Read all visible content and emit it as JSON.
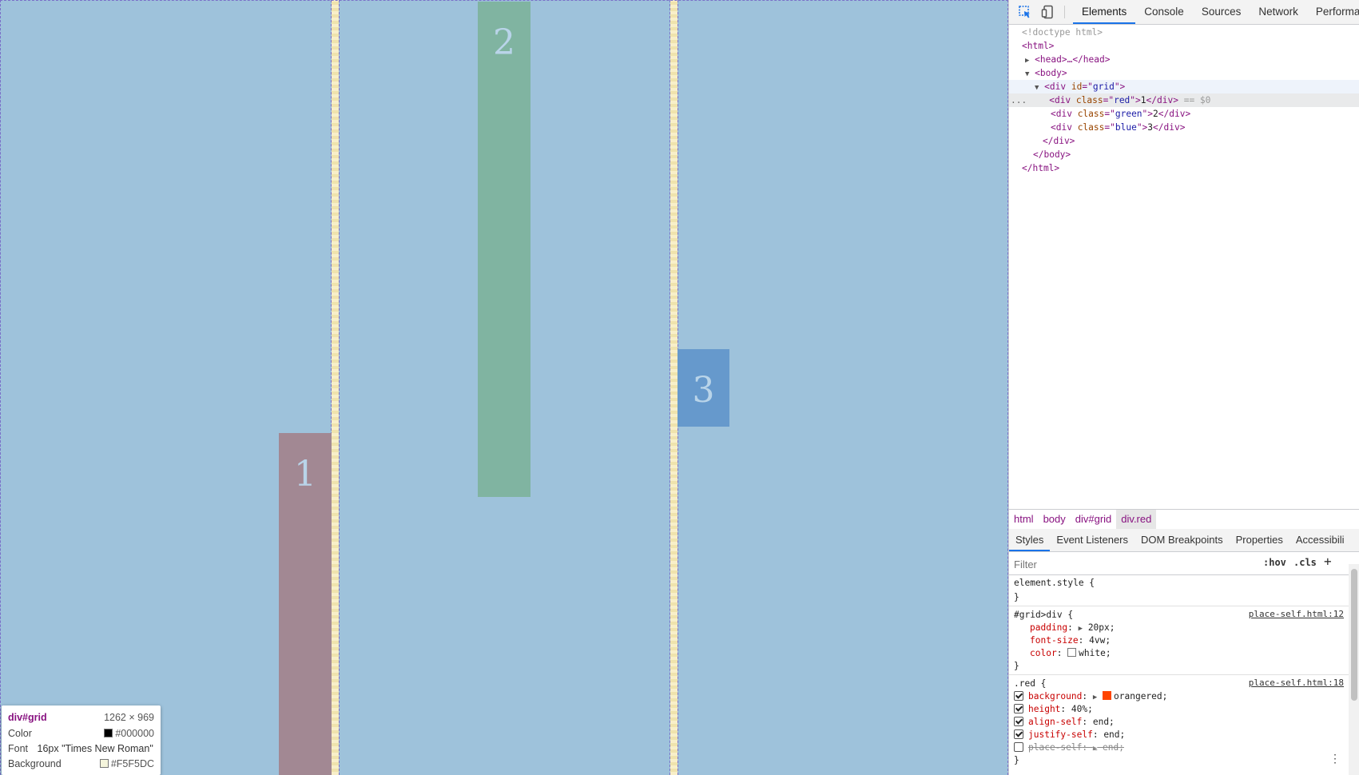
{
  "page": {
    "items": [
      {
        "label": "1",
        "class": "red",
        "color": "#A28893"
      },
      {
        "label": "2",
        "class": "green",
        "color": "#80B4A1"
      },
      {
        "label": "3",
        "class": "blue",
        "color": "#6699CC"
      }
    ],
    "column_color": "#9EC2DB",
    "gap_color": "#F5F5DC"
  },
  "tooltip": {
    "selector": "div#grid",
    "size": "1262 × 969",
    "color_label": "Color",
    "color_value": "#000000",
    "font_label": "Font",
    "font_value": "16px \"Times New Roman\"",
    "bg_label": "Background",
    "bg_value": "#F5F5DC"
  },
  "devtools": {
    "tabs": [
      "Elements",
      "Console",
      "Sources",
      "Network",
      "Performa"
    ],
    "active_tab": "Elements",
    "dom": {
      "doctype": "<!doctype html>",
      "html_open": "<html>",
      "head": "<head>…</head>",
      "body_open": "<body>",
      "grid_open_tag": "div",
      "grid_attr": "id",
      "grid_val": "grid",
      "red_attr": "class",
      "red_val": "red",
      "red_text": "1",
      "selected_marker": "== $0",
      "green_val": "green",
      "green_text": "2",
      "blue_val": "blue",
      "blue_text": "3",
      "div_close": "</div>",
      "body_close": "</body>",
      "html_close": "</html>",
      "ellipsis": "..."
    },
    "breadcrumbs": [
      "html",
      "body",
      "div#grid",
      "div.red"
    ],
    "subtabs": [
      "Styles",
      "Event Listeners",
      "DOM Breakpoints",
      "Properties",
      "Accessibili"
    ],
    "filter_placeholder": "Filter",
    "hov": ":hov",
    "cls": ".cls",
    "plus": "+",
    "styles": {
      "element_style": "element.style {",
      "close_brace": "}",
      "rule1_selector": "#grid>div {",
      "rule1_source": "place-self.html:12",
      "rule1_props": [
        {
          "name": "padding",
          "value": "20px;"
        },
        {
          "name": "font-size",
          "value": "4vw;"
        },
        {
          "name": "color",
          "value": "white;"
        }
      ],
      "rule2_selector": ".red {",
      "rule2_source": "place-self.html:18",
      "rule2_props": [
        {
          "name": "background",
          "value": "orangered;",
          "checked": true
        },
        {
          "name": "height",
          "value": "40%;",
          "checked": true
        },
        {
          "name": "align-self",
          "value": "end;",
          "checked": true
        },
        {
          "name": "justify-self",
          "value": "end;",
          "checked": true
        },
        {
          "name": "place-self",
          "value": "end;",
          "checked": false
        }
      ],
      "swatch_orangered": "#FF4500",
      "swatch_white": "#FFFFFF"
    }
  }
}
